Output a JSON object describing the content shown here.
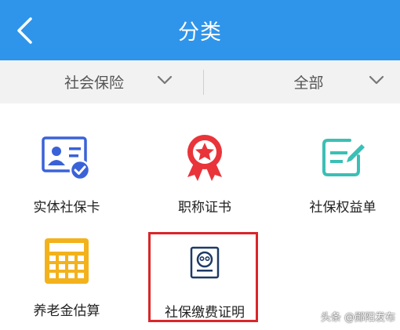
{
  "header": {
    "title": "分类"
  },
  "filters": {
    "category": "社会保险",
    "scope": "全部"
  },
  "items": [
    {
      "label": "实体社保卡",
      "icon": "social-security-card-icon"
    },
    {
      "label": "职称证书",
      "icon": "certificate-medal-icon"
    },
    {
      "label": "社保权益单",
      "icon": "rights-statement-icon"
    },
    {
      "label": "养老金估算",
      "icon": "calculator-icon"
    },
    {
      "label": "社保缴费证明",
      "icon": "payment-proof-icon"
    }
  ],
  "watermark": "头条 @郧阳发布",
  "colors": {
    "header": "#2f95ea",
    "highlight": "#d9262b"
  }
}
